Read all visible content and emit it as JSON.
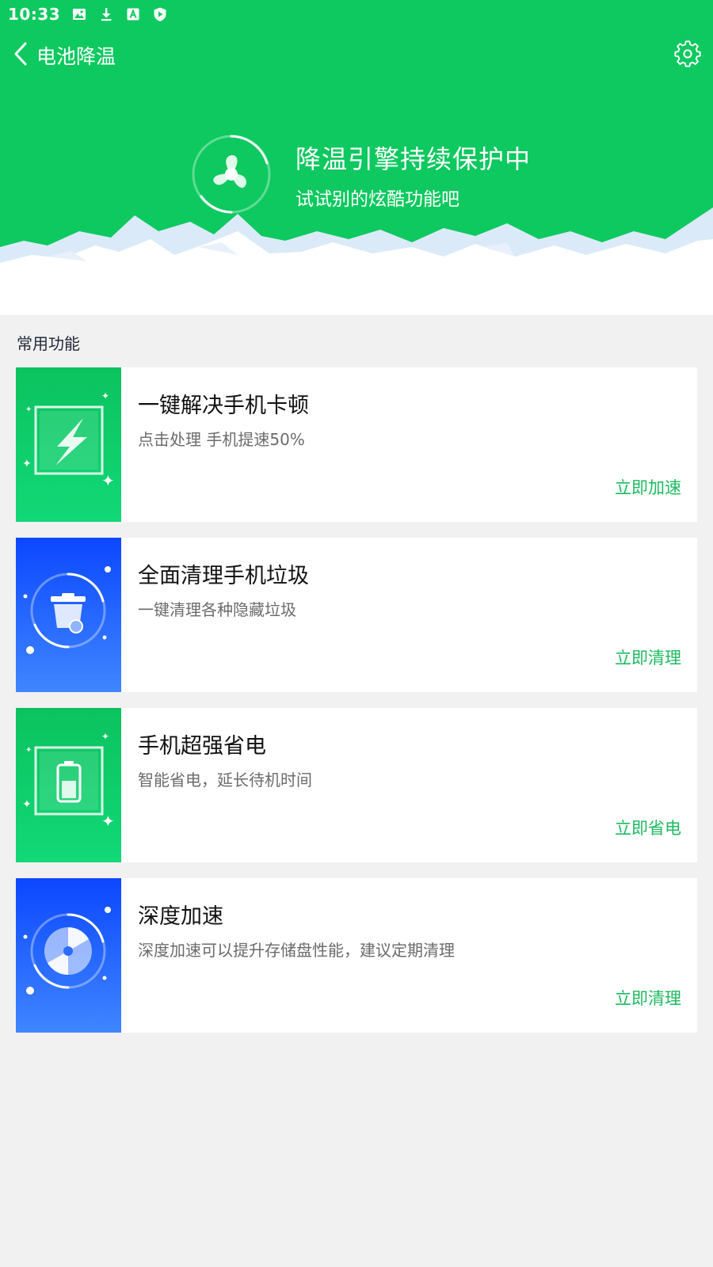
{
  "status_bar": {
    "time": "10:33",
    "icons": [
      "image-icon",
      "download-icon",
      "app-store-icon",
      "play-shield-icon"
    ]
  },
  "nav": {
    "title": "电池降温",
    "back_icon": "back-icon",
    "settings_icon": "gear-icon"
  },
  "hero": {
    "title": "降温引擎持续保护中",
    "subtitle": "试试别的炫酷功能吧",
    "icon": "fan-icon",
    "color": "#0dc95f"
  },
  "section": {
    "title": "常用功能"
  },
  "cards": [
    {
      "title": "一键解决手机卡顿",
      "desc": "点击处理 手机提速50%",
      "action": "立即加速",
      "icon": "lightning-icon",
      "theme": "#0bc35e"
    },
    {
      "title": "全面清理手机垃圾",
      "desc": "一键清理各种隐藏垃圾",
      "action": "立即清理",
      "icon": "trash-icon",
      "theme": "#1f5cff"
    },
    {
      "title": "手机超强省电",
      "desc": "智能省电，延长待机时间",
      "action": "立即省电",
      "icon": "battery-icon",
      "theme": "#0bc35e"
    },
    {
      "title": "深度加速",
      "desc": "深度加速可以提升存储盘性能，建议定期清理",
      "action": "立即清理",
      "icon": "disk-icon",
      "theme": "#1f5cff"
    }
  ],
  "colors": {
    "accent": "#1dba5f",
    "background": "#f1f1f2"
  }
}
